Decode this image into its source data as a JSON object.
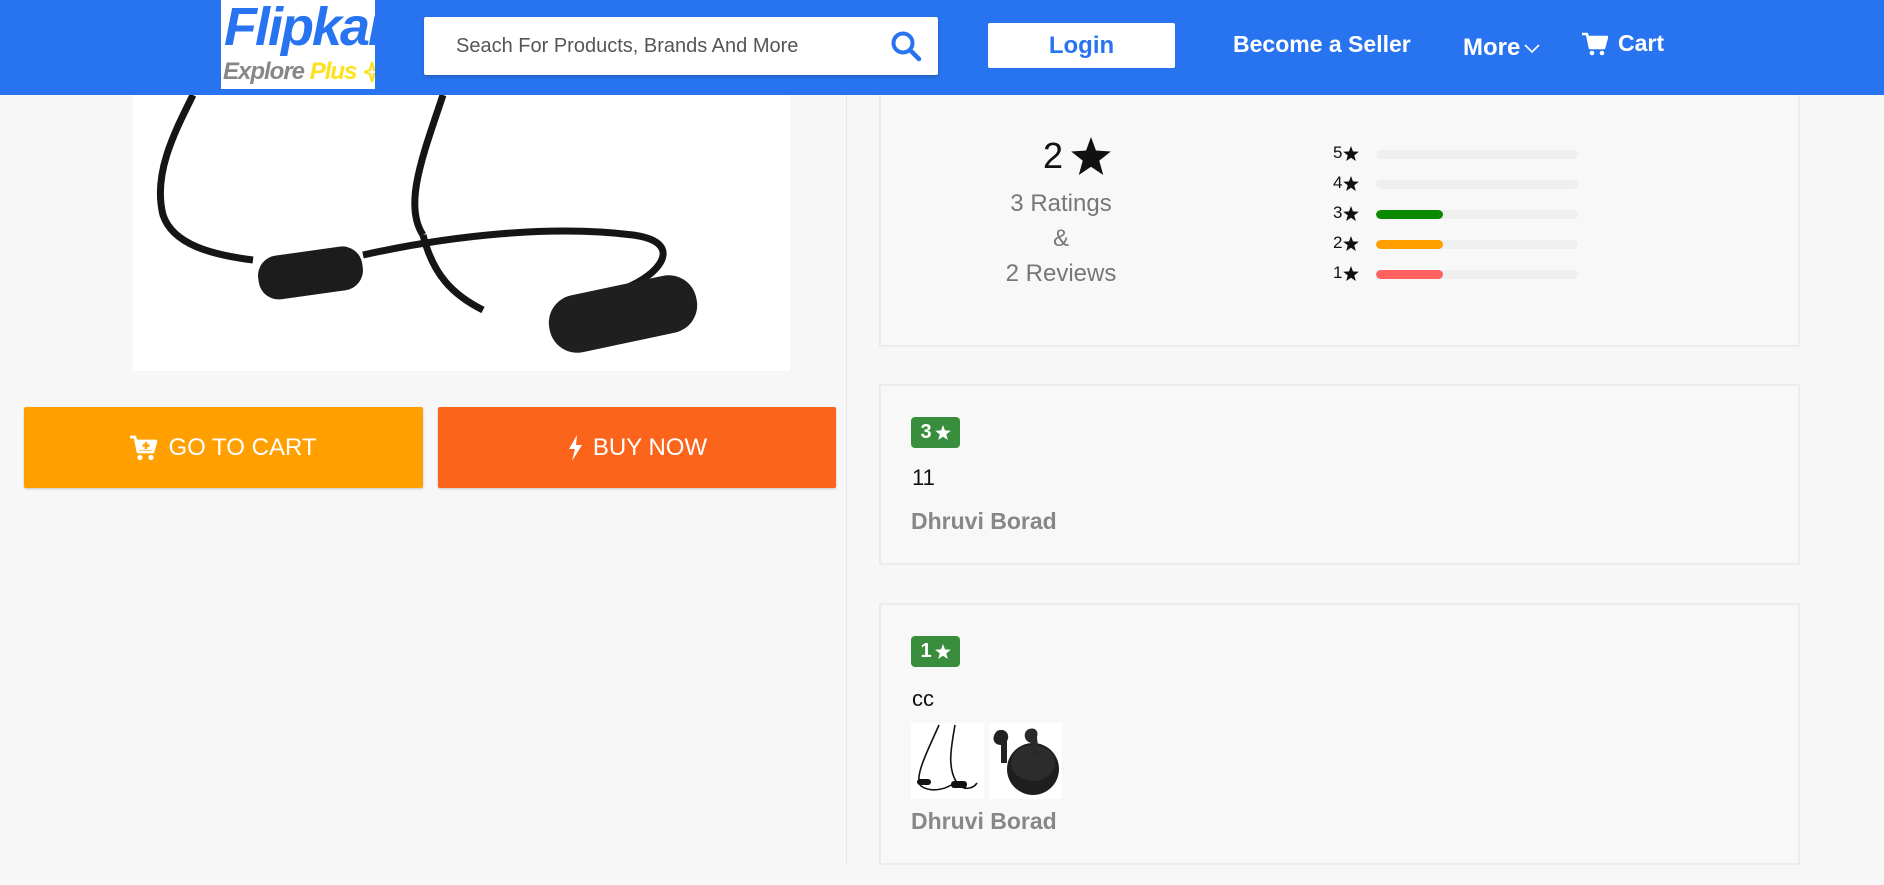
{
  "header": {
    "logo_main": "Flipkart",
    "logo_sub_text": "Explore",
    "logo_sub_plus": "Plus",
    "search_placeholder": "Seach For Products, Brands And More",
    "login_label": "Login",
    "seller_label": "Become a Seller",
    "more_label": "More",
    "cart_label": "Cart"
  },
  "actions": {
    "go_to_cart": "GO TO CART",
    "buy_now": "BUY NOW"
  },
  "rating_summary": {
    "average": "2",
    "ratings_count": "3 Ratings",
    "ampersand": "&",
    "reviews_count": "2 Reviews",
    "distribution": [
      {
        "stars": "5",
        "fraction": 0,
        "color": "#ff6161"
      },
      {
        "stars": "4",
        "fraction": 0,
        "color": "#ff6161"
      },
      {
        "stars": "3",
        "fraction": 0.333,
        "color": "#0a8a00"
      },
      {
        "stars": "2",
        "fraction": 0.333,
        "color": "#ff9f00"
      },
      {
        "stars": "1",
        "fraction": 0.333,
        "color": "#ff6161"
      }
    ]
  },
  "reviews": [
    {
      "rating": "3",
      "text": "11",
      "author": "Dhruvi Borad"
    },
    {
      "rating": "1",
      "text": "cc",
      "author": "Dhruvi Borad"
    }
  ],
  "colors": {
    "brand": "#2874f0",
    "cart_button": "#ff9f00",
    "buy_button": "#fb641b",
    "rating_badge": "#388e3c"
  }
}
